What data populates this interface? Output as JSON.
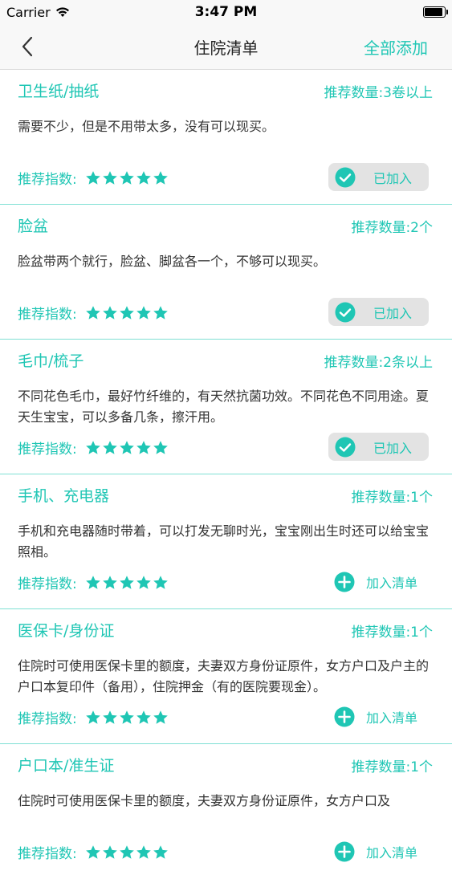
{
  "status_bar": {
    "carrier": "Carrier",
    "time": "3:47 PM"
  },
  "nav": {
    "title": "住院清单",
    "action": "全部添加"
  },
  "colors": {
    "accent": "#1fc6b4",
    "added_bg": "#e3e3e3"
  },
  "rating_label": "推荐指数:",
  "items": [
    {
      "name": "卫生纸/抽纸",
      "qty": "推荐数量:3卷以上",
      "desc": "需要不少，但是不用带太多，没有可以现买。",
      "stars": 5,
      "status": "added",
      "button_label": "已加入"
    },
    {
      "name": "脸盆",
      "qty": "推荐数量:2个",
      "desc": "脸盆带两个就行，脸盆、脚盆各一个，不够可以现买。",
      "stars": 5,
      "status": "added",
      "button_label": "已加入"
    },
    {
      "name": "毛巾/梳子",
      "qty": "推荐数量:2条以上",
      "desc": "不同花色毛巾，最好竹纤维的，有天然抗菌功效。不同花色不同用途。夏天生宝宝，可以多备几条，擦汗用。",
      "stars": 5,
      "status": "added",
      "button_label": "已加入"
    },
    {
      "name": "手机、充电器",
      "qty": "推荐数量:1个",
      "desc": "手机和充电器随时带着，可以打发无聊时光，宝宝刚出生时还可以给宝宝照相。",
      "stars": 5,
      "status": "add",
      "button_label": "加入清单"
    },
    {
      "name": "医保卡/身份证",
      "qty": "推荐数量:1个",
      "desc": "住院时可使用医保卡里的额度，夫妻双方身份证原件，女方户口及户主的户口本复印件（备用），住院押金（有的医院要现金）。",
      "stars": 5,
      "status": "add",
      "button_label": "加入清单"
    },
    {
      "name": "户口本/准生证",
      "qty": "推荐数量:1个",
      "desc": "住院时可使用医保卡里的额度，夫妻双方身份证原件，女方户口及",
      "stars": 5,
      "status": "add",
      "button_label": "加入清单"
    }
  ]
}
